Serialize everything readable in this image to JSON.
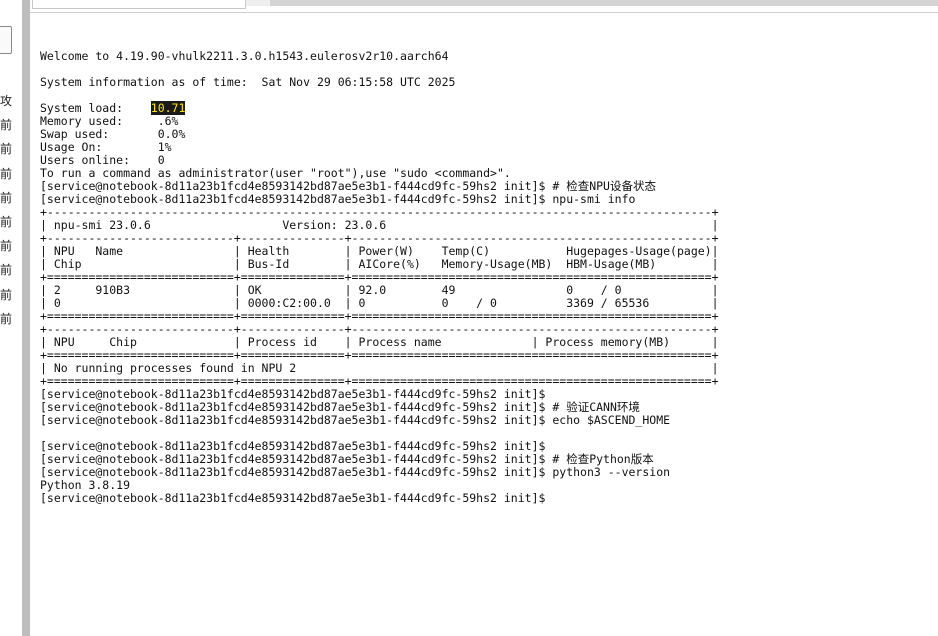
{
  "left_panel": {
    "labels": [
      "攻",
      "前",
      "前",
      "前",
      "前",
      "前",
      "前",
      "前",
      "前",
      "前"
    ]
  },
  "terminal": {
    "welcome": "Welcome to 4.19.90-vhulk2211.3.0.h1543.eulerosv2r10.aarch64",
    "sysinfo": "System information as of time:  Sat Nov 29 06:15:58 UTC 2025",
    "load_label": "System load:    ",
    "load_value": "10.71",
    "memory": "Memory used:     .6%",
    "swap": "Swap used:       0.0%",
    "usage": "Usage On:        1%",
    "users": "Users online:    0",
    "hint": "To run a command as administrator(user \"root\"),use \"sudo <command>\".",
    "lines_before_table": [
      "[service@notebook-8d11a23b1fcd4e8593142bd87ae5e3b1-f444cd9fc-59hs2 init]$ # 检查NPU设备状态",
      "[service@notebook-8d11a23b1fcd4e8593142bd87ae5e3b1-f444cd9fc-59hs2 init]$ npu-smi info"
    ],
    "table_lines": [
      "+------------------------------------------------------------------------------------------------+",
      "| npu-smi 23.0.6                   Version: 23.0.6                                               |",
      "+---------------------------+---------------+----------------------------------------------------+",
      "| NPU   Name                | Health        | Power(W)    Temp(C)           Hugepages-Usage(page)|",
      "| Chip                      | Bus-Id        | AICore(%)   Memory-Usage(MB)  HBM-Usage(MB)        |",
      "+===========================+===============+====================================================+",
      "| 2     910B3               | OK            | 92.0        49                0    / 0             |",
      "| 0                         | 0000:C2:00.0  | 0           0    / 0          3369 / 65536         |",
      "+===========================+===============+====================================================+",
      "+---------------------------+---------------+----------------------------------------------------+",
      "| NPU     Chip              | Process id    | Process name             | Process memory(MB)      |",
      "+===========================+===============+====================================================+",
      "| No running processes found in NPU 2                                                            |",
      "+===========================+===============+====================================================+"
    ],
    "lines_after_table": [
      "[service@notebook-8d11a23b1fcd4e8593142bd87ae5e3b1-f444cd9fc-59hs2 init]$",
      "[service@notebook-8d11a23b1fcd4e8593142bd87ae5e3b1-f444cd9fc-59hs2 init]$ # 验证CANN环境",
      "[service@notebook-8d11a23b1fcd4e8593142bd87ae5e3b1-f444cd9fc-59hs2 init]$ echo $ASCEND_HOME",
      "",
      "[service@notebook-8d11a23b1fcd4e8593142bd87ae5e3b1-f444cd9fc-59hs2 init]$",
      "[service@notebook-8d11a23b1fcd4e8593142bd87ae5e3b1-f444cd9fc-59hs2 init]$ # 检查Python版本",
      "[service@notebook-8d11a23b1fcd4e8593142bd87ae5e3b1-f444cd9fc-59hs2 init]$ python3 --version",
      "Python 3.8.19",
      "[service@notebook-8d11a23b1fcd4e8593142bd87ae5e3b1-f444cd9fc-59hs2 init]$"
    ]
  }
}
